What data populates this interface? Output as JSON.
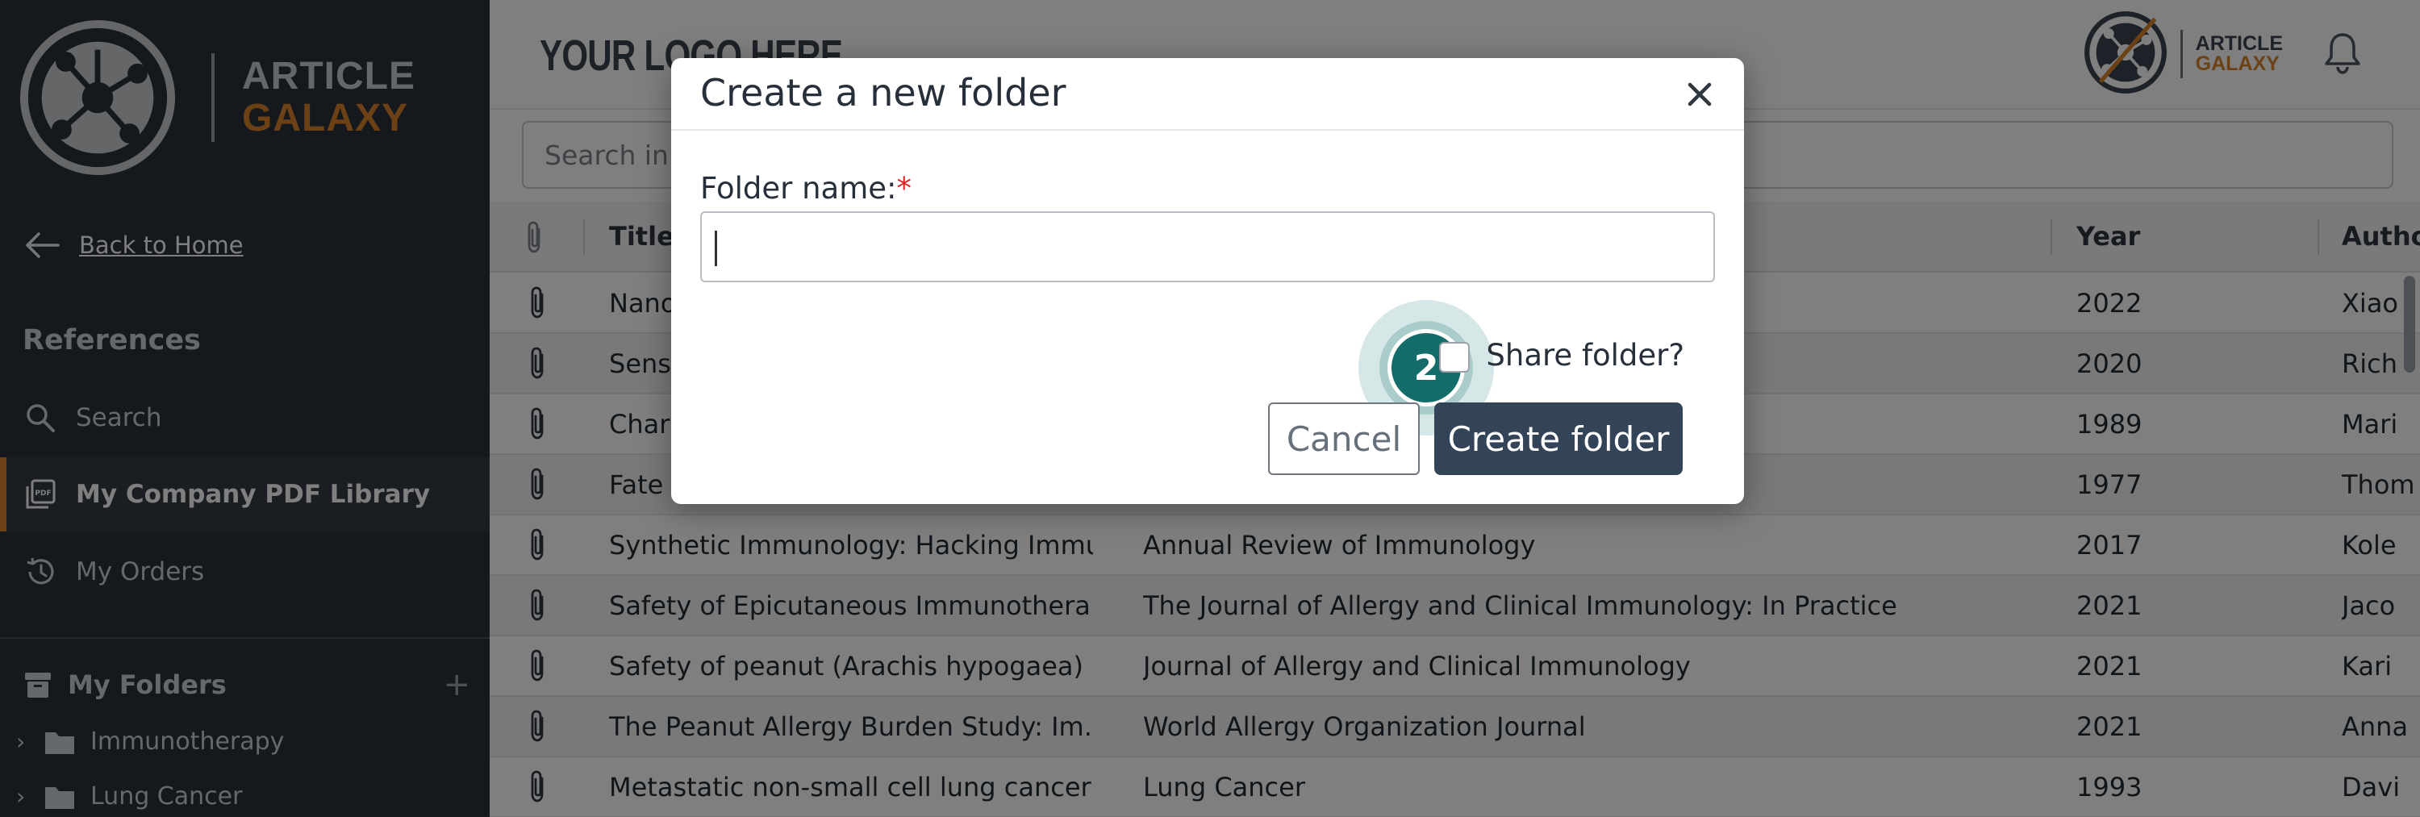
{
  "brand": {
    "word1": "ARTICLE",
    "word2": "GALAXY"
  },
  "sidebar": {
    "back_label": "Back to Home",
    "section_title": "References",
    "nav": [
      {
        "label": "Search",
        "icon": "search-icon"
      },
      {
        "label": "My Company PDF Library",
        "icon": "pdf-library-icon",
        "active": true
      },
      {
        "label": "My Orders",
        "icon": "history-icon"
      }
    ],
    "folders_title": "My Folders",
    "folders_add": "+",
    "folders": [
      {
        "label": "Immunotherapy"
      },
      {
        "label": "Lung Cancer"
      }
    ]
  },
  "header": {
    "logo_text": "YOUR LOGO HERE",
    "mini_word1": "ARTICLE",
    "mini_word2": "GALAXY"
  },
  "search": {
    "placeholder": "Search in library"
  },
  "table": {
    "columns": [
      "Title",
      "Year",
      "Autho"
    ],
    "rows": [
      {
        "title": "Nano",
        "journal": "",
        "year": "2022",
        "author": "Xiao"
      },
      {
        "title": "Sens",
        "journal": "",
        "year": "2020",
        "author": "Rich"
      },
      {
        "title": "Chara",
        "journal": "",
        "year": "1989",
        "author": "Mari"
      },
      {
        "title": "Fate",
        "journal": "",
        "year": "1977",
        "author": "Thom"
      },
      {
        "title": "Synthetic Immunology: Hacking Immu...",
        "journal": "Annual Review of Immunology",
        "year": "2017",
        "author": "Kole"
      },
      {
        "title": "Safety of Epicutaneous Immunothera...",
        "journal": "The Journal of Allergy and Clinical Immunology: In Practice",
        "year": "2021",
        "author": "Jaco"
      },
      {
        "title": "Safety of peanut (Arachis hypogaea) ...",
        "journal": "Journal of Allergy and Clinical Immunology",
        "year": "2021",
        "author": "Kari"
      },
      {
        "title": "The Peanut Allergy Burden Study: Im...",
        "journal": "World Allergy Organization Journal",
        "year": "2021",
        "author": "Anna"
      },
      {
        "title": "Metastatic non-small cell lung cancer",
        "journal": "Lung Cancer",
        "year": "1993",
        "author": "Davi"
      }
    ]
  },
  "modal": {
    "title": "Create a new folder",
    "field_label": "Folder name:",
    "required_mark": "*",
    "input_value": "",
    "share_label": "Share folder?",
    "cancel_label": "Cancel",
    "create_label": "Create folder",
    "step_number": "2"
  },
  "colors": {
    "sidebar_bg": "#2a323c",
    "accent_orange": "#d7822a",
    "primary_button": "#334458",
    "step_badge": "#146c6a",
    "required": "#d62728"
  }
}
